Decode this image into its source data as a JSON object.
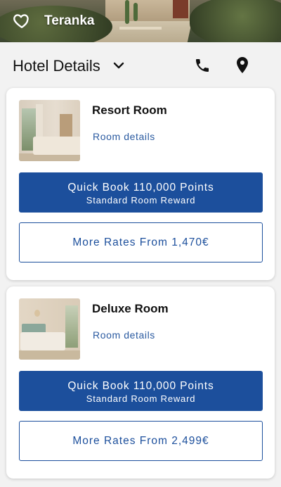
{
  "hero": {
    "title": "Teranka",
    "icon": "heart-icon"
  },
  "header": {
    "title": "Hotel Details",
    "icons": [
      "chevron-down-icon",
      "phone-icon",
      "location-pin-icon"
    ]
  },
  "rooms": [
    {
      "name": "Resort Room",
      "details_link": "Room details",
      "quick_book": "Quick Book 110,000 Points",
      "reward": "Standard Room Reward",
      "more_rates": "More Rates From 1,470€"
    },
    {
      "name": "Deluxe Room",
      "details_link": "Room details",
      "quick_book": "Quick Book 110,000 Points",
      "reward": "Standard Room Reward",
      "more_rates": "More Rates From 2,499€"
    }
  ],
  "colors": {
    "primary": "#1c4f9c",
    "link": "#2a5aa0",
    "background": "#f2f2f2"
  }
}
